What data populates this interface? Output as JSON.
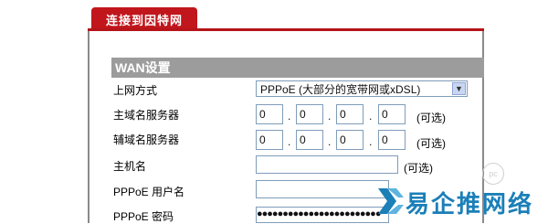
{
  "tab": {
    "label": "连接到因特网"
  },
  "section": {
    "title": "WAN设置"
  },
  "fields": {
    "connection_type": {
      "label": "上网方式",
      "value": "PPPoE (大部分的宽带网或xDSL)"
    },
    "primary_dns": {
      "label": "主域名服务器",
      "octets": [
        "0",
        "0",
        "0",
        "0"
      ],
      "hint": "(可选)"
    },
    "secondary_dns": {
      "label": "辅域名服务器",
      "octets": [
        "0",
        "0",
        "0",
        "0"
      ],
      "hint": "(可选)"
    },
    "hostname": {
      "label": "主机名",
      "value": "",
      "hint": "(可选)"
    },
    "pppoe_user": {
      "label": "PPPoE 用户名",
      "value": ""
    },
    "pppoe_password": {
      "label": "PPPoE 密码",
      "value": "●●●●●●●●●●●●●●●●●●●●●●●●"
    }
  },
  "watermark": {
    "text": "易企推网络",
    "badge": "pc"
  },
  "colors": {
    "tab": "#c0161c",
    "section": "#9c9c9c",
    "watermark": "#1b7fb8"
  }
}
